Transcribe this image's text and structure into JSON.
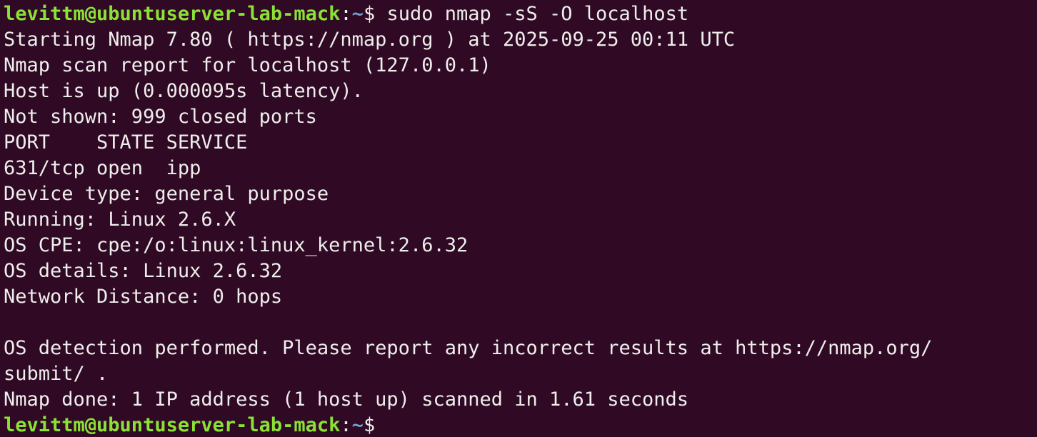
{
  "prompt": {
    "user_host": "levittm@ubuntuserver-lab-mack",
    "separator": ":",
    "path": "~",
    "symbol": "$ "
  },
  "command": "sudo nmap -sS -O localhost",
  "output": [
    "Starting Nmap 7.80 ( https://nmap.org ) at 2025-09-25 00:11 UTC",
    "Nmap scan report for localhost (127.0.0.1)",
    "Host is up (0.000095s latency).",
    "Not shown: 999 closed ports",
    "PORT    STATE SERVICE",
    "631/tcp open  ipp",
    "Device type: general purpose",
    "Running: Linux 2.6.X",
    "OS CPE: cpe:/o:linux:linux_kernel:2.6.32",
    "OS details: Linux 2.6.32",
    "Network Distance: 0 hops",
    "",
    "OS detection performed. Please report any incorrect results at https://nmap.org/",
    "submit/ .",
    "Nmap done: 1 IP address (1 host up) scanned in 1.61 seconds"
  ],
  "colors": {
    "background": "#300a24",
    "text": "#eeeeec",
    "prompt_user_host": "#8ae234",
    "prompt_path": "#729fcf"
  }
}
